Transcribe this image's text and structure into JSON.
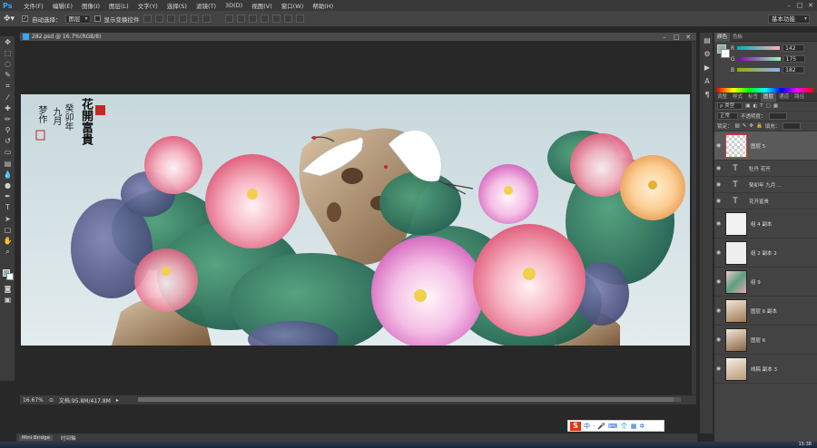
{
  "app": {
    "logo": "Ps",
    "menu": [
      "文件(F)",
      "编辑(E)",
      "图像(I)",
      "图层(L)",
      "文字(Y)",
      "选择(S)",
      "滤镜(T)",
      "3D(D)",
      "视图(V)",
      "窗口(W)",
      "帮助(H)"
    ]
  },
  "options": {
    "auto_select_label": "自动选择：",
    "auto_select_target": "图层",
    "show_transform_label": "显示变换控件",
    "workspace": "基本功能"
  },
  "document": {
    "title": "282.psd @ 16.7%(RGB/8)",
    "zoom": "16.67%",
    "doc_size": "文档:95.8M/417.8M"
  },
  "artwork": {
    "title_chars": "花開富貴",
    "inscription_line1": "癸卯年",
    "inscription_line2": "九月",
    "inscription_line3": "梦作"
  },
  "bottom_tabs": [
    "Mini Bridge",
    "时间轴"
  ],
  "color_panel": {
    "tabs": [
      "颜色",
      "色板"
    ],
    "r_label": "R",
    "r": "142",
    "g_label": "G",
    "g": "175",
    "b_label": "B",
    "b": "182",
    "fg_color": "#8eafb6"
  },
  "layers_panel": {
    "tabs": [
      "调整",
      "样式",
      "标签",
      "图层",
      "通道",
      "路径"
    ],
    "filter_label": "ρ 类型",
    "blend_mode": "正常",
    "opacity_label": "不透明度：",
    "lock_label": "锁定：",
    "fill_label": "填充：",
    "layers": [
      {
        "name": "图层 5",
        "kind": "pixel"
      },
      {
        "name": "牡丹 花开",
        "kind": "text"
      },
      {
        "name": "癸卯年 九月 ...",
        "kind": "text"
      },
      {
        "name": "花开富贵",
        "kind": "text"
      },
      {
        "name": "组 4 副本",
        "kind": "group"
      },
      {
        "name": "组 2 副本 2",
        "kind": "group"
      },
      {
        "name": "组 9",
        "kind": "group"
      },
      {
        "name": "图层 6 副本",
        "kind": "pixel"
      },
      {
        "name": "图层 6",
        "kind": "pixel"
      },
      {
        "name": "线稿 副本 3",
        "kind": "pixel"
      }
    ]
  },
  "taskbar": {
    "clock": "15:38"
  },
  "ime": {
    "logo": "S",
    "mode": "中"
  }
}
